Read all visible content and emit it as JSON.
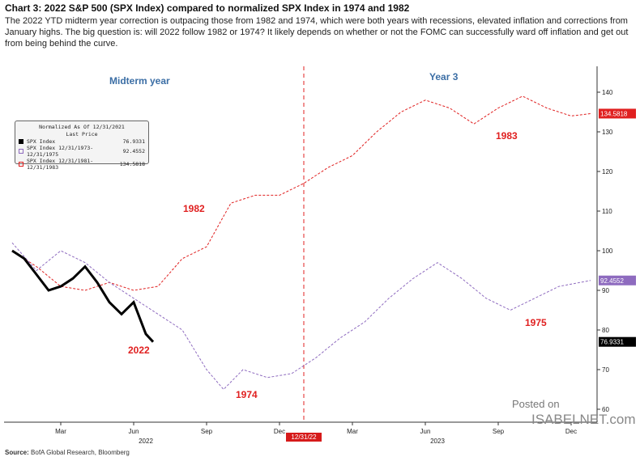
{
  "title": "Chart 3: 2022 S&P 500 (SPX Index) compared to normalized SPX Index in 1974 and 1982",
  "description": "The 2022 YTD midterm year correction is outpacing those from 1982 and 1974, which were both years with recessions, elevated inflation and corrections from January highs. The big question is: will 2022 follow 1982 or 1974? It likely depends on whether or not the FOMC can successfully ward off inflation and get out from being behind the curve.",
  "source_label": "Source:",
  "source": "BofA Global Research, Bloomberg",
  "watermark": {
    "line1": "Posted on",
    "line2": "ISABELNET.com"
  },
  "chart_data": {
    "type": "line",
    "ylim": [
      58,
      146
    ],
    "yticks": [
      60,
      70,
      80,
      90,
      100,
      110,
      120,
      130,
      140
    ],
    "xticks": [
      {
        "label": "Mar",
        "m": 2
      },
      {
        "label": "Jun",
        "m": 5
      },
      {
        "label": "Sep",
        "m": 8
      },
      {
        "label": "Dec",
        "m": 11
      },
      {
        "label": "Mar",
        "m": 14
      },
      {
        "label": "Jun",
        "m": 17
      },
      {
        "label": "Sep",
        "m": 20
      },
      {
        "label": "Dec",
        "m": 23
      }
    ],
    "year_labels": [
      {
        "label": "2022",
        "m": 5.5
      },
      {
        "label": "2023",
        "m": 17.5
      }
    ],
    "divider": {
      "label": "12/31/22",
      "m": 12
    },
    "annotations": {
      "left_period": "Midterm year",
      "right_period": "Year 3",
      "l2022": "2022",
      "l1974": "1974",
      "l1982": "1982",
      "l1975": "1975",
      "l1983": "1983"
    },
    "legend": {
      "header1": "Normalized As Of 12/31/2021",
      "header2": "Last Price"
    },
    "series": [
      {
        "name": "SPX Index",
        "last": "76.9331",
        "color": "#000000",
        "style": "solid",
        "x_months": [
          0,
          0.5,
          1,
          1.5,
          2,
          2.5,
          3,
          3.5,
          4,
          4.5,
          5,
          5.5,
          5.8
        ],
        "values": [
          100,
          98,
          94,
          90,
          91,
          93,
          96,
          92,
          87,
          84,
          87,
          79,
          77
        ]
      },
      {
        "name": "SPX Index 12/31/1973-12/31/1975",
        "last": "92.4552",
        "color": "#8e6bbf",
        "style": "dashed",
        "x_months": [
          0,
          1,
          2,
          3,
          4,
          5,
          6,
          7,
          7.5,
          8,
          8.7,
          9.5,
          10.5,
          11.5,
          12.5,
          13.5,
          14.5,
          15.5,
          16.5,
          17.5,
          18.5,
          19.5,
          20.5,
          21.5,
          22.5,
          23.8
        ],
        "values": [
          102,
          95,
          100,
          97,
          92,
          88,
          84,
          80,
          75,
          70,
          65,
          70,
          68,
          69,
          73,
          78,
          82,
          88,
          93,
          97,
          93,
          88,
          85,
          88,
          91,
          92.5
        ]
      },
      {
        "name": "SPX Index 12/31/1981-12/31/1983",
        "last": "134.5818",
        "color": "#e02020",
        "style": "dashed",
        "x_months": [
          0,
          1,
          2,
          3,
          4,
          5,
          6,
          7,
          8,
          9,
          10,
          11,
          12,
          13,
          14,
          15,
          16,
          17,
          18,
          19,
          20,
          21,
          22,
          23,
          23.8
        ],
        "values": [
          100,
          96,
          91,
          90,
          92,
          90,
          91,
          98,
          101,
          112,
          114,
          114,
          117,
          121,
          124,
          130,
          135,
          138,
          136,
          132,
          136,
          139,
          136,
          134,
          134.6
        ]
      }
    ]
  }
}
